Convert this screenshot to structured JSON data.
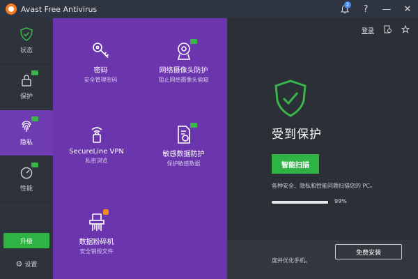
{
  "window": {
    "title": "Avast Free Antivirus",
    "notification_count": "2",
    "help": "?",
    "minimize": "—",
    "close": "✕"
  },
  "sidebar": {
    "items": [
      {
        "label": "状态"
      },
      {
        "label": "保护"
      },
      {
        "label": "隐私"
      },
      {
        "label": "性能"
      }
    ],
    "upgrade_label": "升级",
    "settings_label": "设置"
  },
  "privacy_panel": {
    "tiles": [
      {
        "title": "密码",
        "subtitle": "安全管理密码"
      },
      {
        "title": "网络摄像头防护",
        "subtitle": "阻止网络摄像头偷窥"
      },
      {
        "title": "SecureLine VPN",
        "subtitle": "私密浏览"
      },
      {
        "title": "敏感数据防护",
        "subtitle": "保护敏感数据"
      },
      {
        "title": "数据粉碎机",
        "subtitle": "安全销毁文件"
      }
    ]
  },
  "main": {
    "login_label": "登录",
    "status_text": "受到保护",
    "scan_button": "智能扫描",
    "scan_description": "各种安全、隐私和性能问题扫描您的 PC。",
    "progress": {
      "value": 99,
      "label": "99%"
    },
    "mobile_text": "度并优化手机。",
    "install_button": "免费安装"
  },
  "colors": {
    "purple": "#6b35ad",
    "green": "#2fb344",
    "sidebar": "#2e333b",
    "background": "#2b2f36"
  }
}
